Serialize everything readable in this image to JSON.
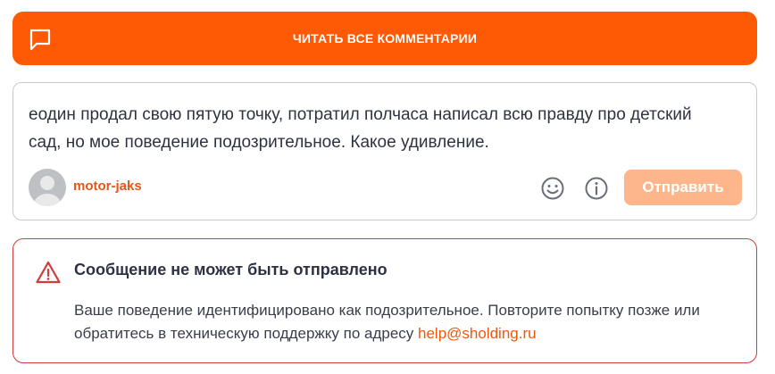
{
  "read_all": {
    "label": "ЧИТАТЬ ВСЕ КОММЕНТАРИИ",
    "icon": "comment-icon"
  },
  "composer": {
    "text": "еодин продал свою пятую точку, потратил полчаса написал всю правду про детский сад, но мое поведение подозрительное. Какое удивление.",
    "username": "motor-jaks",
    "send_label": "Отправить",
    "emoji_icon": "smiley-icon",
    "info_icon": "info-icon"
  },
  "error": {
    "title": "Сообщение не может быть отправлено",
    "message": "Ваше поведение идентифицировано как подозрительное. Повторите попытку позже или обратитесь в техническую поддержку по адресу ",
    "email": "help@sholding.ru",
    "icon": "warning-icon"
  },
  "colors": {
    "accent": "#fe5a06",
    "send_disabled": "#fdb68c",
    "error_border": "#d13b3b",
    "username": "#e2571a"
  }
}
